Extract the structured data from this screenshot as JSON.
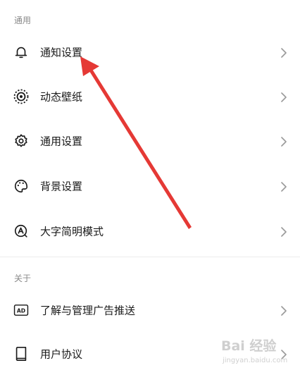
{
  "sections": {
    "general": {
      "header": "通用"
    },
    "about": {
      "header": "关于"
    }
  },
  "general_items": [
    {
      "label": "通知设置",
      "icon": "bell-icon"
    },
    {
      "label": "动态壁纸",
      "icon": "dynamic-wallpaper-icon"
    },
    {
      "label": "通用设置",
      "icon": "gear-icon"
    },
    {
      "label": "背景设置",
      "icon": "palette-icon"
    },
    {
      "label": "大字简明模式",
      "icon": "large-font-icon"
    }
  ],
  "about_items": [
    {
      "label": "了解与管理广告推送",
      "icon": "ad-icon"
    },
    {
      "label": "用户协议",
      "icon": "book-icon"
    }
  ],
  "annotation": {
    "type": "arrow",
    "color": "#e53935"
  },
  "watermark": {
    "brand": "Bai 经验",
    "url": "jingyan.baidu.com"
  },
  "colors": {
    "text": "#1a1a1a",
    "muted": "#8a8a8a",
    "chevron": "#9a9a9a",
    "arrow": "#e53935"
  }
}
